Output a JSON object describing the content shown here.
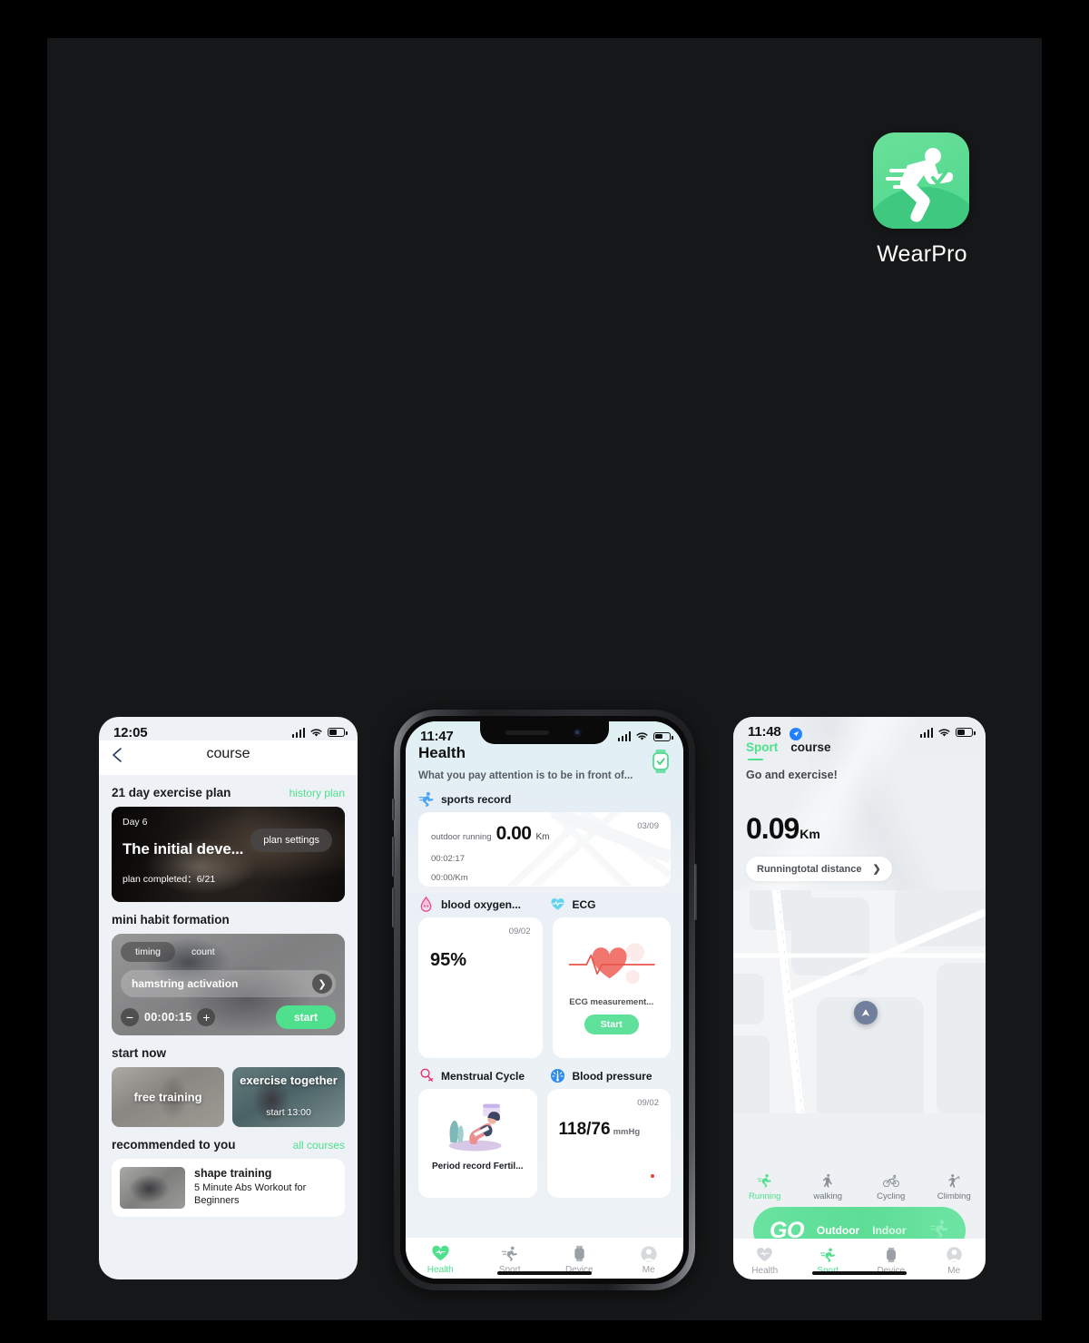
{
  "app": {
    "name": "WearPro",
    "icon_name": "running-man-icon",
    "icon_bg": "#5ddc94"
  },
  "colors": {
    "accent_green": "#4ee08d",
    "panel_bg": "#161718",
    "screen_bg": "#eef2f6"
  },
  "phone1": {
    "status": {
      "time": "12:05",
      "signal_icon": "signal-bars-icon",
      "wifi_icon": "wifi-icon",
      "battery_icon": "battery-icon"
    },
    "header": {
      "back_icon": "chevron-left-icon",
      "title": "course"
    },
    "plan_section": {
      "title": "21 day exercise plan",
      "link": "history plan"
    },
    "plan_card": {
      "day": "Day 6",
      "title": "The initial deve...",
      "completed_label": "plan completed：",
      "completed_value": "6/21",
      "settings_button": "plan settings"
    },
    "habit_section": {
      "title": "mini habit formation"
    },
    "habit_card": {
      "tab_timing": "timing",
      "tab_count": "count",
      "exercise": "hamstring activation",
      "chevron_icon": "chevron-right-icon",
      "minus_icon": "minus-icon",
      "plus_icon": "plus-icon",
      "time": "00:00:15",
      "start_button": "start"
    },
    "start_now": {
      "title": "start now"
    },
    "cards": [
      {
        "label": "free training"
      },
      {
        "label": "exercise together",
        "sub": "start  13:00"
      }
    ],
    "recommended": {
      "title": "recommended to you",
      "link": "all courses"
    },
    "rec_card": {
      "title": "shape training",
      "subtitle": "5 Minute Abs Workout for Beginners"
    }
  },
  "phone2": {
    "status": {
      "time": "11:47",
      "signal_icon": "signal-bars-icon",
      "wifi_icon": "wifi-icon",
      "battery_icon": "battery-icon"
    },
    "header": {
      "title": "Health",
      "watch_icon": "smartwatch-icon"
    },
    "tagline": "What you pay attention is to be in front of...",
    "sports_record": {
      "icon": "runner-icon",
      "heading": "sports record",
      "type": "outdoor running",
      "distance": "0.00",
      "unit": "Km",
      "date": "03/09",
      "duration": "00:02:17",
      "pace": "00:00/Km"
    },
    "blood_oxygen": {
      "icon": "blood-drop-icon",
      "heading": "blood oxygen...",
      "date": "09/02",
      "value": "95%"
    },
    "ecg": {
      "icon": "heart-icon",
      "heading": "ECG",
      "caption": "ECG measurement...",
      "start_button": "Start"
    },
    "menstrual": {
      "icon": "female-symbol-icon",
      "heading": "Menstrual Cycle",
      "caption": "Period record Fertil..."
    },
    "blood_pressure": {
      "icon": "pressure-gauge-icon",
      "heading": "Blood pressure",
      "date": "09/02",
      "value": "118/76",
      "unit": "mmHg"
    },
    "tabs": [
      {
        "label": "Health",
        "icon": "heart-pulse-icon",
        "active": true
      },
      {
        "label": "Sport",
        "icon": "runner-icon",
        "active": false
      },
      {
        "label": "Device",
        "icon": "smartwatch-icon",
        "active": false
      },
      {
        "label": "Me",
        "icon": "person-icon",
        "active": false
      }
    ]
  },
  "phone3": {
    "status": {
      "time": "11:48",
      "location_icon": "location-arrow-icon",
      "signal_icon": "signal-bars-icon",
      "wifi_icon": "wifi-icon",
      "battery_icon": "battery-icon"
    },
    "tabs": [
      {
        "label": "Sport",
        "active": true
      },
      {
        "label": "course",
        "active": false
      }
    ],
    "prompt": "Go and exercise!",
    "distance": {
      "value": "0.09",
      "unit": "Km"
    },
    "distance_button": {
      "label": "Runningtotal distance",
      "chevron_icon": "chevron-right-icon"
    },
    "map": {
      "marker_icon": "navigation-arrow-icon"
    },
    "modes": [
      {
        "label": "Running",
        "icon": "runner-icon",
        "active": true
      },
      {
        "label": "walking",
        "icon": "walking-icon",
        "active": false
      },
      {
        "label": "Cycling",
        "icon": "bicycle-icon",
        "active": false
      },
      {
        "label": "Climbing",
        "icon": "climbing-icon",
        "active": false
      }
    ],
    "go_bar": {
      "go": "GO",
      "outdoor": "Outdoor",
      "indoor": "Indoor",
      "runner_icon": "runner-icon"
    },
    "tabs_bottom": [
      {
        "label": "Health",
        "icon": "heart-pulse-icon",
        "active": false
      },
      {
        "label": "Sport",
        "icon": "runner-icon",
        "active": true
      },
      {
        "label": "Device",
        "icon": "smartwatch-icon",
        "active": false
      },
      {
        "label": "Me",
        "icon": "person-icon",
        "active": false
      }
    ]
  }
}
